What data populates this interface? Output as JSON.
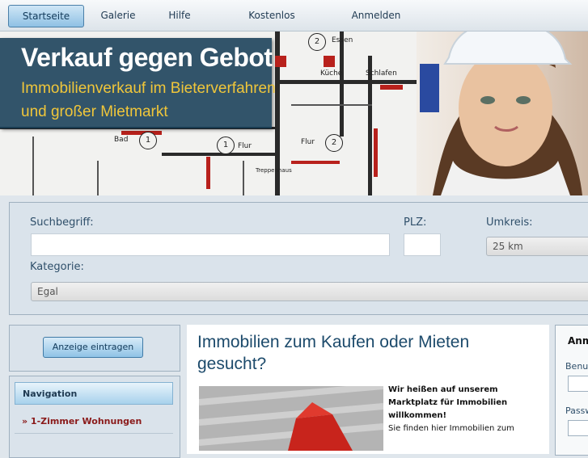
{
  "nav": {
    "items": [
      {
        "label": "Startseite",
        "active": true
      },
      {
        "label": "Galerie",
        "active": false
      },
      {
        "label": "Hilfe",
        "active": false
      },
      {
        "label": "Kostenlos registrieren",
        "active": false
      },
      {
        "label": "Anmelden",
        "active": false
      }
    ]
  },
  "banner": {
    "title": "Verkauf gegen Gebot",
    "subtitle_line1": "Immobilienverkauf im Bieterverfahren",
    "subtitle_line2": "und großer Mietmarkt",
    "blueprint_labels": [
      "Essen",
      "Küche",
      "Schlafen",
      "Bad",
      "Flur",
      "Flur",
      "Treppenhaus"
    ],
    "blueprint_numbers": [
      "2",
      "1",
      "1",
      "2"
    ]
  },
  "search": {
    "keyword_label": "Suchbegriff:",
    "keyword_value": "",
    "plz_label": "PLZ:",
    "plz_value": "",
    "radius_label": "Umkreis:",
    "radius_value": "25 km",
    "category_label": "Kategorie:",
    "category_value": "Egal"
  },
  "sidebar": {
    "add_button": "Anzeige eintragen",
    "nav_heading": "Navigation",
    "nav_links": [
      "» 1-Zimmer Wohnungen"
    ]
  },
  "main": {
    "title": "Immobilien zum Kaufen oder Mieten gesucht?",
    "welcome": "Wir heißen auf unserem Marktplatz für Immobilien willkommen!",
    "intro": "Sie finden hier Immobilien zum"
  },
  "login": {
    "heading": "Anm",
    "user_label": "Benu",
    "pass_label": "Passw"
  },
  "colors": {
    "banner_box": "#173e56",
    "banner_sub": "#f0c63a",
    "title_blue": "#1c4a6b",
    "link_red": "#8a1a1a"
  }
}
